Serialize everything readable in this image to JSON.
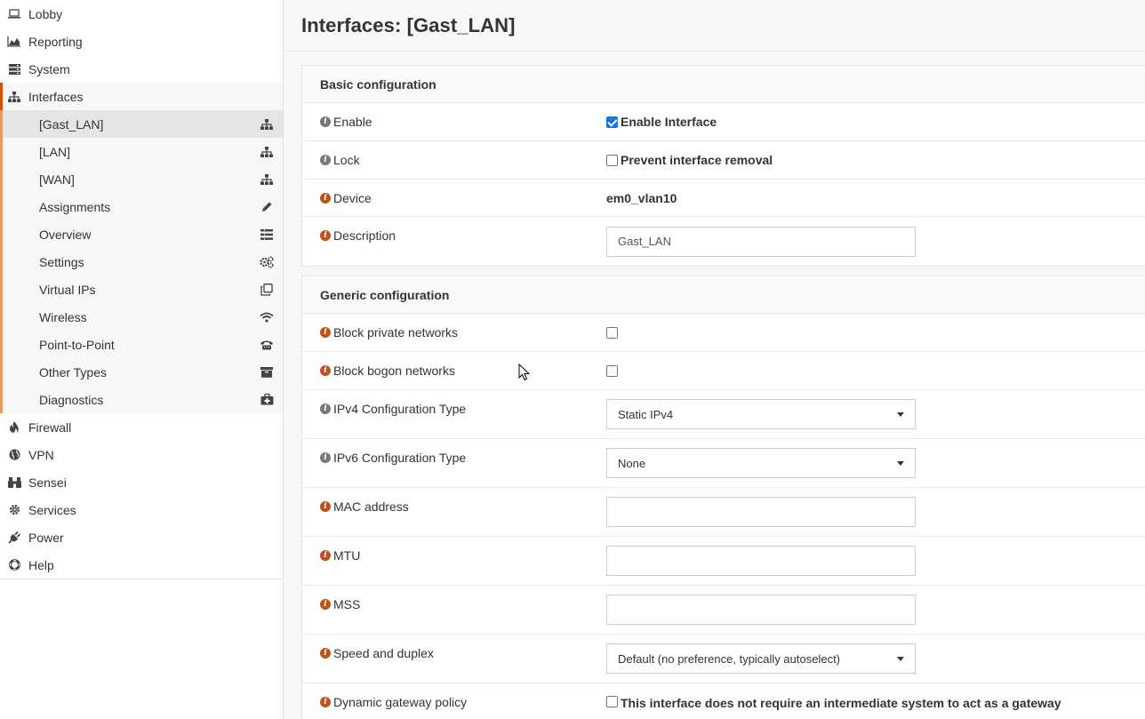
{
  "sidebar": {
    "items": [
      {
        "label": "Lobby",
        "icon": "laptop-icon"
      },
      {
        "label": "Reporting",
        "icon": "area-chart-icon"
      },
      {
        "label": "System",
        "icon": "server-icon"
      },
      {
        "label": "Interfaces",
        "icon": "sitemap-icon"
      }
    ],
    "sub_items": [
      {
        "label": "[Gast_LAN]",
        "icon": "sitemap-icon"
      },
      {
        "label": "[LAN]",
        "icon": "sitemap-icon"
      },
      {
        "label": "[WAN]",
        "icon": "sitemap-icon"
      },
      {
        "label": "Assignments",
        "icon": "pencil-icon"
      },
      {
        "label": "Overview",
        "icon": "list-icon"
      },
      {
        "label": "Settings",
        "icon": "cogs-icon"
      },
      {
        "label": "Virtual IPs",
        "icon": "clone-icon"
      },
      {
        "label": "Wireless",
        "icon": "wifi-icon"
      },
      {
        "label": "Point-to-Point",
        "icon": "phone-icon"
      },
      {
        "label": "Other Types",
        "icon": "archive-icon"
      },
      {
        "label": "Diagnostics",
        "icon": "medkit-icon"
      }
    ],
    "bottom_items": [
      {
        "label": "Firewall",
        "icon": "fire-icon"
      },
      {
        "label": "VPN",
        "icon": "globe-icon"
      },
      {
        "label": "Sensei",
        "icon": "binoculars-icon"
      },
      {
        "label": "Services",
        "icon": "cog-icon"
      },
      {
        "label": "Power",
        "icon": "plug-icon"
      },
      {
        "label": "Help",
        "icon": "life-ring-icon"
      }
    ]
  },
  "page": {
    "title": "Interfaces: [Gast_LAN]"
  },
  "basic": {
    "header": "Basic configuration",
    "enable_label": "Enable",
    "enable_checkbox": "Enable Interface",
    "lock_label": "Lock",
    "lock_checkbox": "Prevent interface removal",
    "device_label": "Device",
    "device_value": "em0_vlan10",
    "description_label": "Description",
    "description_value": "Gast_LAN"
  },
  "generic": {
    "header": "Generic configuration",
    "block_private_label": "Block private networks",
    "block_bogon_label": "Block bogon networks",
    "ipv4_label": "IPv4 Configuration Type",
    "ipv4_value": "Static IPv4",
    "ipv6_label": "IPv6 Configuration Type",
    "ipv6_value": "None",
    "mac_label": "MAC address",
    "mtu_label": "MTU",
    "mss_label": "MSS",
    "speed_label": "Speed and duplex",
    "speed_value": "Default (no preference, typically autoselect)",
    "gateway_label": "Dynamic gateway policy",
    "gateway_checkbox": "This interface does not require an intermediate system to act as a gateway"
  },
  "colors": {
    "accent": "#d94f00",
    "submenu_border": "#ea9a5a",
    "info_icon": "#c0501c"
  }
}
